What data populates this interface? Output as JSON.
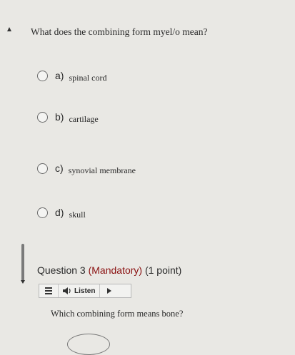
{
  "question": {
    "text": "What does the combining form myel/o mean?",
    "options": [
      {
        "letter": "a)",
        "text": "spinal cord"
      },
      {
        "letter": "b)",
        "text": "cartilage"
      },
      {
        "letter": "c)",
        "text": "synovial membrane"
      },
      {
        "letter": "d)",
        "text": "skull"
      }
    ]
  },
  "next_question": {
    "number_label": "Question 3",
    "mandatory_label": "(Mandatory)",
    "points_label": "(1 point)",
    "listen_label": "Listen",
    "text": "Which combining form means bone?"
  },
  "colors": {
    "background": "#e9e8e4",
    "mandatory": "#8a1010"
  },
  "icons": [
    "scroll-up-icon",
    "menu-icon",
    "speaker-icon",
    "play-icon",
    "scroll-down-icon"
  ]
}
